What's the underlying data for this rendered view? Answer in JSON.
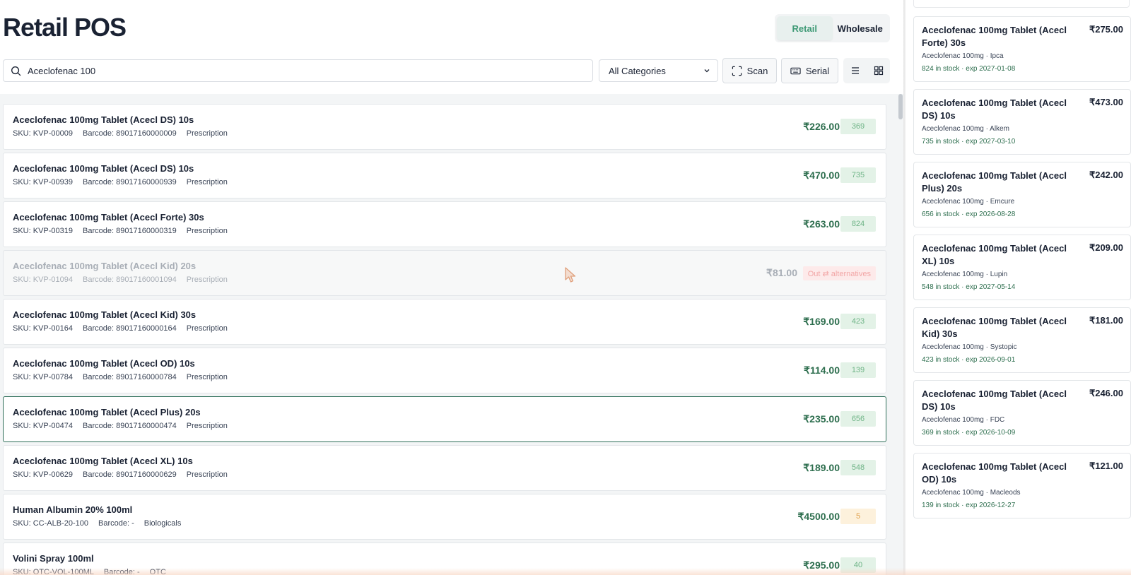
{
  "page_title": "Retail POS",
  "mode_toggle": {
    "retail": "Retail",
    "wholesale": "Wholesale"
  },
  "search": {
    "value": "Aceclofenac 100",
    "icon": "search-icon"
  },
  "category_select": {
    "value": "All Categories"
  },
  "toolbar": {
    "scan_label": "Scan",
    "serial_label": "Serial"
  },
  "colors": {
    "accent": "#3f9a76",
    "price": "#2d6e4e",
    "stock_badge_bg": "#e3f2e7",
    "low_badge_bg": "#fdf1dc",
    "oos_badge_bg": "#fdeaea",
    "selected_border": "#2d6e58"
  },
  "products": [
    {
      "name": "Aceclofenac 100mg Tablet (Acecl DS) 10s",
      "sku": "SKU: KVP-00009",
      "barcode": "Barcode: 89017160000009",
      "category": "Prescription",
      "price": "₹226.00",
      "stock": "369"
    },
    {
      "name": "Aceclofenac 100mg Tablet (Acecl DS) 10s",
      "sku": "SKU: KVP-00939",
      "barcode": "Barcode: 89017160000939",
      "category": "Prescription",
      "price": "₹470.00",
      "stock": "735"
    },
    {
      "name": "Aceclofenac 100mg Tablet (Acecl Forte) 30s",
      "sku": "SKU: KVP-00319",
      "barcode": "Barcode: 89017160000319",
      "category": "Prescription",
      "price": "₹263.00",
      "stock": "824"
    },
    {
      "name": "Aceclofenac 100mg Tablet (Acecl Kid) 20s",
      "sku": "SKU: KVP-01094",
      "barcode": "Barcode: 89017160001094",
      "category": "Prescription",
      "price": "₹81.00",
      "stock_label": "Out ⇄ alternatives"
    },
    {
      "name": "Aceclofenac 100mg Tablet (Acecl Kid) 30s",
      "sku": "SKU: KVP-00164",
      "barcode": "Barcode: 89017160000164",
      "category": "Prescription",
      "price": "₹169.00",
      "stock": "423"
    },
    {
      "name": "Aceclofenac 100mg Tablet (Acecl OD) 10s",
      "sku": "SKU: KVP-00784",
      "barcode": "Barcode: 89017160000784",
      "category": "Prescription",
      "price": "₹114.00",
      "stock": "139"
    },
    {
      "name": "Aceclofenac 100mg Tablet (Acecl Plus) 20s",
      "sku": "SKU: KVP-00474",
      "barcode": "Barcode: 89017160000474",
      "category": "Prescription",
      "price": "₹235.00",
      "stock": "656"
    },
    {
      "name": "Aceclofenac 100mg Tablet (Acecl XL) 10s",
      "sku": "SKU: KVP-00629",
      "barcode": "Barcode: 89017160000629",
      "category": "Prescription",
      "price": "₹189.00",
      "stock": "548"
    },
    {
      "name": "Human Albumin 20% 100ml",
      "sku": "SKU: CC-ALB-20-100",
      "barcode": "Barcode: -",
      "category": "Biologicals",
      "price": "₹4500.00",
      "stock": "5"
    },
    {
      "name": "Volini Spray 100ml",
      "sku": "SKU: OTC-VOL-100ML",
      "barcode": "Barcode: -",
      "category": "OTC",
      "price": "₹295.00",
      "stock": "40"
    }
  ],
  "alternatives": [
    {
      "name": "Aceclofenac 100mg Tablet (Acecl Forte) 30s",
      "price": "₹275.00",
      "sub": "Aceclofenac 100mg · Ipca",
      "stock": "824 in stock · exp 2027-01-08"
    },
    {
      "name": "Aceclofenac 100mg Tablet (Acecl DS) 10s",
      "price": "₹473.00",
      "sub": "Aceclofenac 100mg · Alkem",
      "stock": "735 in stock · exp 2027-03-10"
    },
    {
      "name": "Aceclofenac 100mg Tablet (Acecl Plus) 20s",
      "price": "₹242.00",
      "sub": "Aceclofenac 100mg · Emcure",
      "stock": "656 in stock · exp 2026-08-28"
    },
    {
      "name": "Aceclofenac 100mg Tablet (Acecl XL) 10s",
      "price": "₹209.00",
      "sub": "Aceclofenac 100mg · Lupin",
      "stock": "548 in stock · exp 2027-05-14"
    },
    {
      "name": "Aceclofenac 100mg Tablet (Acecl Kid) 30s",
      "price": "₹181.00",
      "sub": "Aceclofenac 100mg · Systopic",
      "stock": "423 in stock · exp 2026-09-01"
    },
    {
      "name": "Aceclofenac 100mg Tablet (Acecl DS) 10s",
      "price": "₹246.00",
      "sub": "Aceclofenac 100mg · FDC",
      "stock": "369 in stock · exp 2026-10-09"
    },
    {
      "name": "Aceclofenac 100mg Tablet (Acecl OD) 10s",
      "price": "₹121.00",
      "sub": "Aceclofenac 100mg · Macleods",
      "stock": "139 in stock · exp 2026-12-27"
    }
  ]
}
